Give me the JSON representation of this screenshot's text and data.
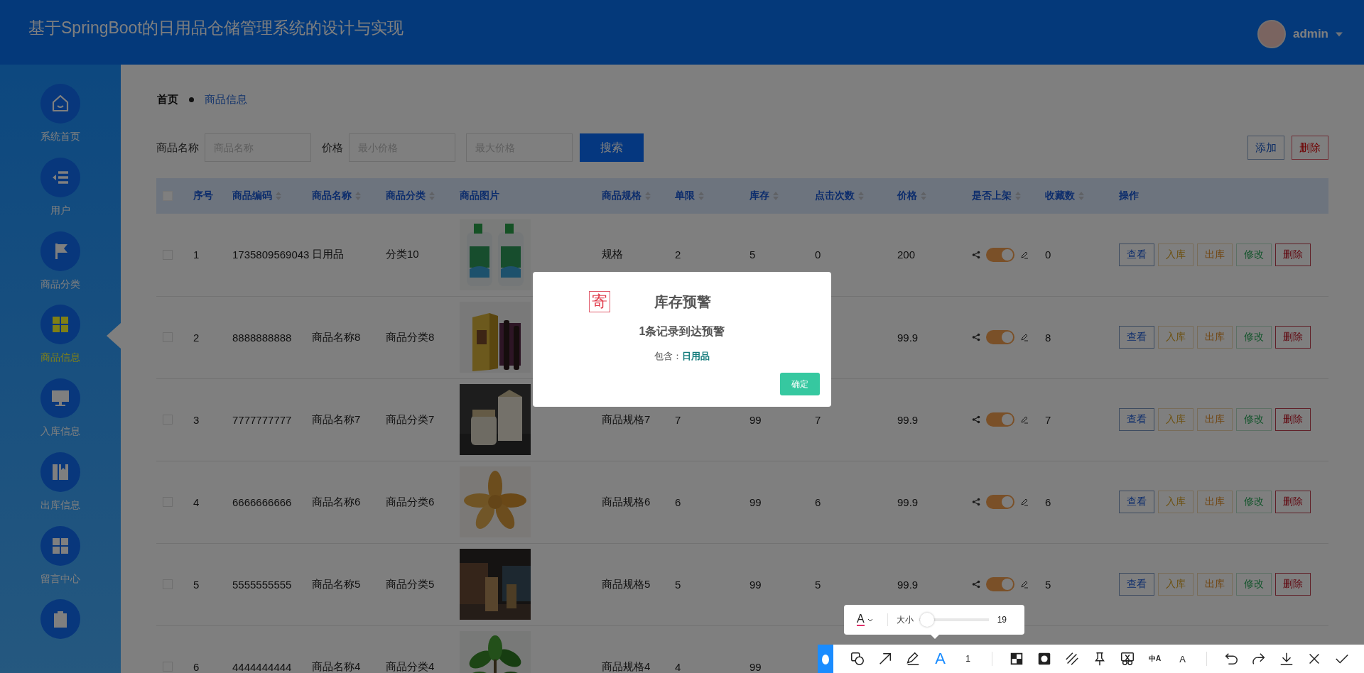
{
  "header": {
    "title": "基于SpringBoot的日用品仓储管理系统的设计与实现",
    "user": "admin"
  },
  "sidebar": {
    "items": [
      {
        "label": "系统首页",
        "selected": false
      },
      {
        "label": "用户",
        "selected": false
      },
      {
        "label": "商品分类",
        "selected": false
      },
      {
        "label": "商品信息",
        "selected": true
      },
      {
        "label": "入库信息",
        "selected": false
      },
      {
        "label": "出库信息",
        "selected": false
      },
      {
        "label": "留言中心",
        "selected": false
      },
      {
        "selected": false
      }
    ]
  },
  "breadcrumb": [
    "首页",
    "商品信息"
  ],
  "filters": {
    "name_label": "商品名称",
    "name_placeholder": "商品名称",
    "price_label": "价格",
    "min_placeholder": "最小价格",
    "max_placeholder": "最大价格",
    "search_button": "搜索"
  },
  "toolbar_buttons": [
    {
      "label": "添加",
      "kind": "add"
    },
    {
      "label": "删除",
      "kind": "delete"
    }
  ],
  "table": {
    "columns": [
      {
        "kind": "checkbox",
        "checked": false
      },
      {
        "label": "序号",
        "sortable": false
      },
      {
        "label": "商品编码",
        "sortable": true
      },
      {
        "label": "商品名称",
        "sortable": true
      },
      {
        "label": "商品分类",
        "sortable": true
      },
      {
        "label": "商品图片",
        "sortable": false
      },
      {
        "label": "商品规格",
        "sortable": true
      },
      {
        "label": "单限",
        "sortable": true
      },
      {
        "label": "库存",
        "sortable": true
      },
      {
        "label": "点击次数",
        "sortable": true
      },
      {
        "label": "价格",
        "sortable": true
      },
      {
        "label": "是否上架",
        "sortable": true
      },
      {
        "label": "收藏数",
        "sortable": true
      },
      {
        "label": "操作",
        "sortable": false
      }
    ],
    "rows": [
      {
        "checked": false,
        "index": "1",
        "code": "1735809569043",
        "name": "日用品",
        "category": "分类10",
        "image": {
          "kind": "picture"
        },
        "spec": "规格",
        "limit": "2",
        "stock": "5",
        "clicks": "0",
        "price": "200",
        "on_shelf": true,
        "favorites": "0",
        "actions": [
          {
            "label": "查看",
            "kind": "view"
          },
          {
            "label": "入库",
            "kind": "in"
          },
          {
            "label": "出库",
            "kind": "out"
          },
          {
            "label": "修改",
            "kind": "edit"
          },
          {
            "label": "删除",
            "kind": "delete"
          }
        ]
      },
      {
        "checked": false,
        "index": "2",
        "code": "8888888888",
        "name": "商品名称8",
        "category": "商品分类8",
        "image": {
          "kind": "picture"
        },
        "price": "99.9",
        "on_shelf": true,
        "favorites": "8",
        "actions": [
          {
            "label": "查看",
            "kind": "view"
          },
          {
            "label": "入库",
            "kind": "in"
          },
          {
            "label": "出库",
            "kind": "out"
          },
          {
            "label": "修改",
            "kind": "edit"
          },
          {
            "label": "删除",
            "kind": "delete"
          }
        ]
      },
      {
        "checked": false,
        "index": "3",
        "code": "7777777777",
        "name": "商品名称7",
        "category": "商品分类7",
        "image": {
          "kind": "picture"
        },
        "spec": "商品规格7",
        "limit": "7",
        "stock": "99",
        "clicks": "7",
        "price": "99.9",
        "on_shelf": true,
        "favorites": "7",
        "actions": [
          {
            "label": "查看",
            "kind": "view"
          },
          {
            "label": "入库",
            "kind": "in"
          },
          {
            "label": "出库",
            "kind": "out"
          },
          {
            "label": "修改",
            "kind": "edit"
          },
          {
            "label": "删除",
            "kind": "delete"
          }
        ]
      },
      {
        "checked": false,
        "index": "4",
        "code": "6666666666",
        "name": "商品名称6",
        "category": "商品分类6",
        "image": {
          "kind": "picture"
        },
        "spec": "商品规格6",
        "limit": "6",
        "stock": "99",
        "clicks": "6",
        "price": "99.9",
        "on_shelf": true,
        "favorites": "6",
        "actions": [
          {
            "label": "查看",
            "kind": "view"
          },
          {
            "label": "入库",
            "kind": "in"
          },
          {
            "label": "出库",
            "kind": "out"
          },
          {
            "label": "修改",
            "kind": "edit"
          },
          {
            "label": "删除",
            "kind": "delete"
          }
        ]
      },
      {
        "checked": false,
        "index": "5",
        "code": "5555555555",
        "name": "商品名称5",
        "category": "商品分类5",
        "image": {
          "kind": "picture"
        },
        "spec": "商品规格5",
        "limit": "5",
        "stock": "99",
        "clicks": "5",
        "price": "99.9",
        "on_shelf": true,
        "favorites": "5",
        "actions": [
          {
            "label": "查看",
            "kind": "view"
          },
          {
            "label": "入库",
            "kind": "in"
          },
          {
            "label": "出库",
            "kind": "out"
          },
          {
            "label": "修改",
            "kind": "edit"
          },
          {
            "label": "删除",
            "kind": "delete"
          }
        ]
      },
      {
        "checked": false,
        "index": "6",
        "code": "4444444444",
        "name": "商品名称4",
        "category": "商品分类4",
        "image": {
          "kind": "picture"
        },
        "spec": "商品规格4",
        "limit": "4",
        "stock": "99"
      }
    ]
  },
  "dialog": {
    "stamp": "寄",
    "title": "库存预警",
    "message": "1条记录到达预警",
    "detail_label": "包含：",
    "detail_value": "日用品",
    "confirm": "确定"
  },
  "capture_toolbar": {
    "font_button": "A",
    "size_label": "大小",
    "size": {
      "level": 0.12
    },
    "size_value": "19",
    "tools": [
      {
        "kind": "shape",
        "selected": false
      },
      {
        "kind": "arrow",
        "selected": false
      },
      {
        "kind": "pen",
        "selected": false
      },
      {
        "kind": "text",
        "glyph": "A",
        "selected": true
      },
      {
        "kind": "number",
        "glyph": "1",
        "selected": false
      },
      {
        "kind": "mosaic",
        "selected": false
      },
      {
        "kind": "blur",
        "selected": false
      },
      {
        "kind": "hatch",
        "selected": false
      },
      {
        "kind": "pin",
        "selected": false
      },
      {
        "kind": "cut",
        "selected": false
      },
      {
        "kind": "translate",
        "glyph": "中A",
        "selected": false
      },
      {
        "kind": "ocr",
        "glyph": "A",
        "selected": false
      },
      {
        "kind": "undo",
        "selected": false
      },
      {
        "kind": "redo",
        "selected": false
      },
      {
        "kind": "download",
        "selected": false
      },
      {
        "kind": "close",
        "selected": false
      },
      {
        "kind": "done",
        "selected": false
      }
    ]
  }
}
